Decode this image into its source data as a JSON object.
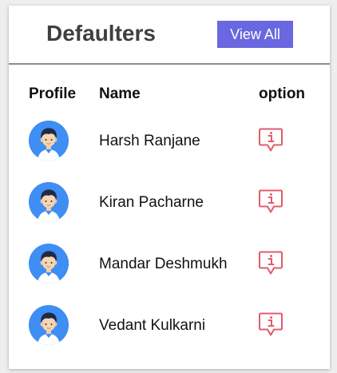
{
  "header": {
    "title": "Defaulters",
    "view_all_label": "View All"
  },
  "table": {
    "columns": [
      "Profile",
      "Name",
      "option"
    ],
    "rows": [
      {
        "name": "Harsh Ranjane",
        "avatar_icon": "user-avatar-icon",
        "option_icon": "info-message-icon"
      },
      {
        "name": "Kiran Pacharne",
        "avatar_icon": "user-avatar-icon",
        "option_icon": "info-message-icon"
      },
      {
        "name": "Mandar Deshmukh",
        "avatar_icon": "user-avatar-icon",
        "option_icon": "info-message-icon"
      },
      {
        "name": "Vedant Kulkarni",
        "avatar_icon": "user-avatar-icon",
        "option_icon": "info-message-icon"
      }
    ]
  },
  "colors": {
    "accent": "#6a67e0",
    "avatar_bg": "#3e8ef3",
    "icon": "#e05c6c"
  }
}
